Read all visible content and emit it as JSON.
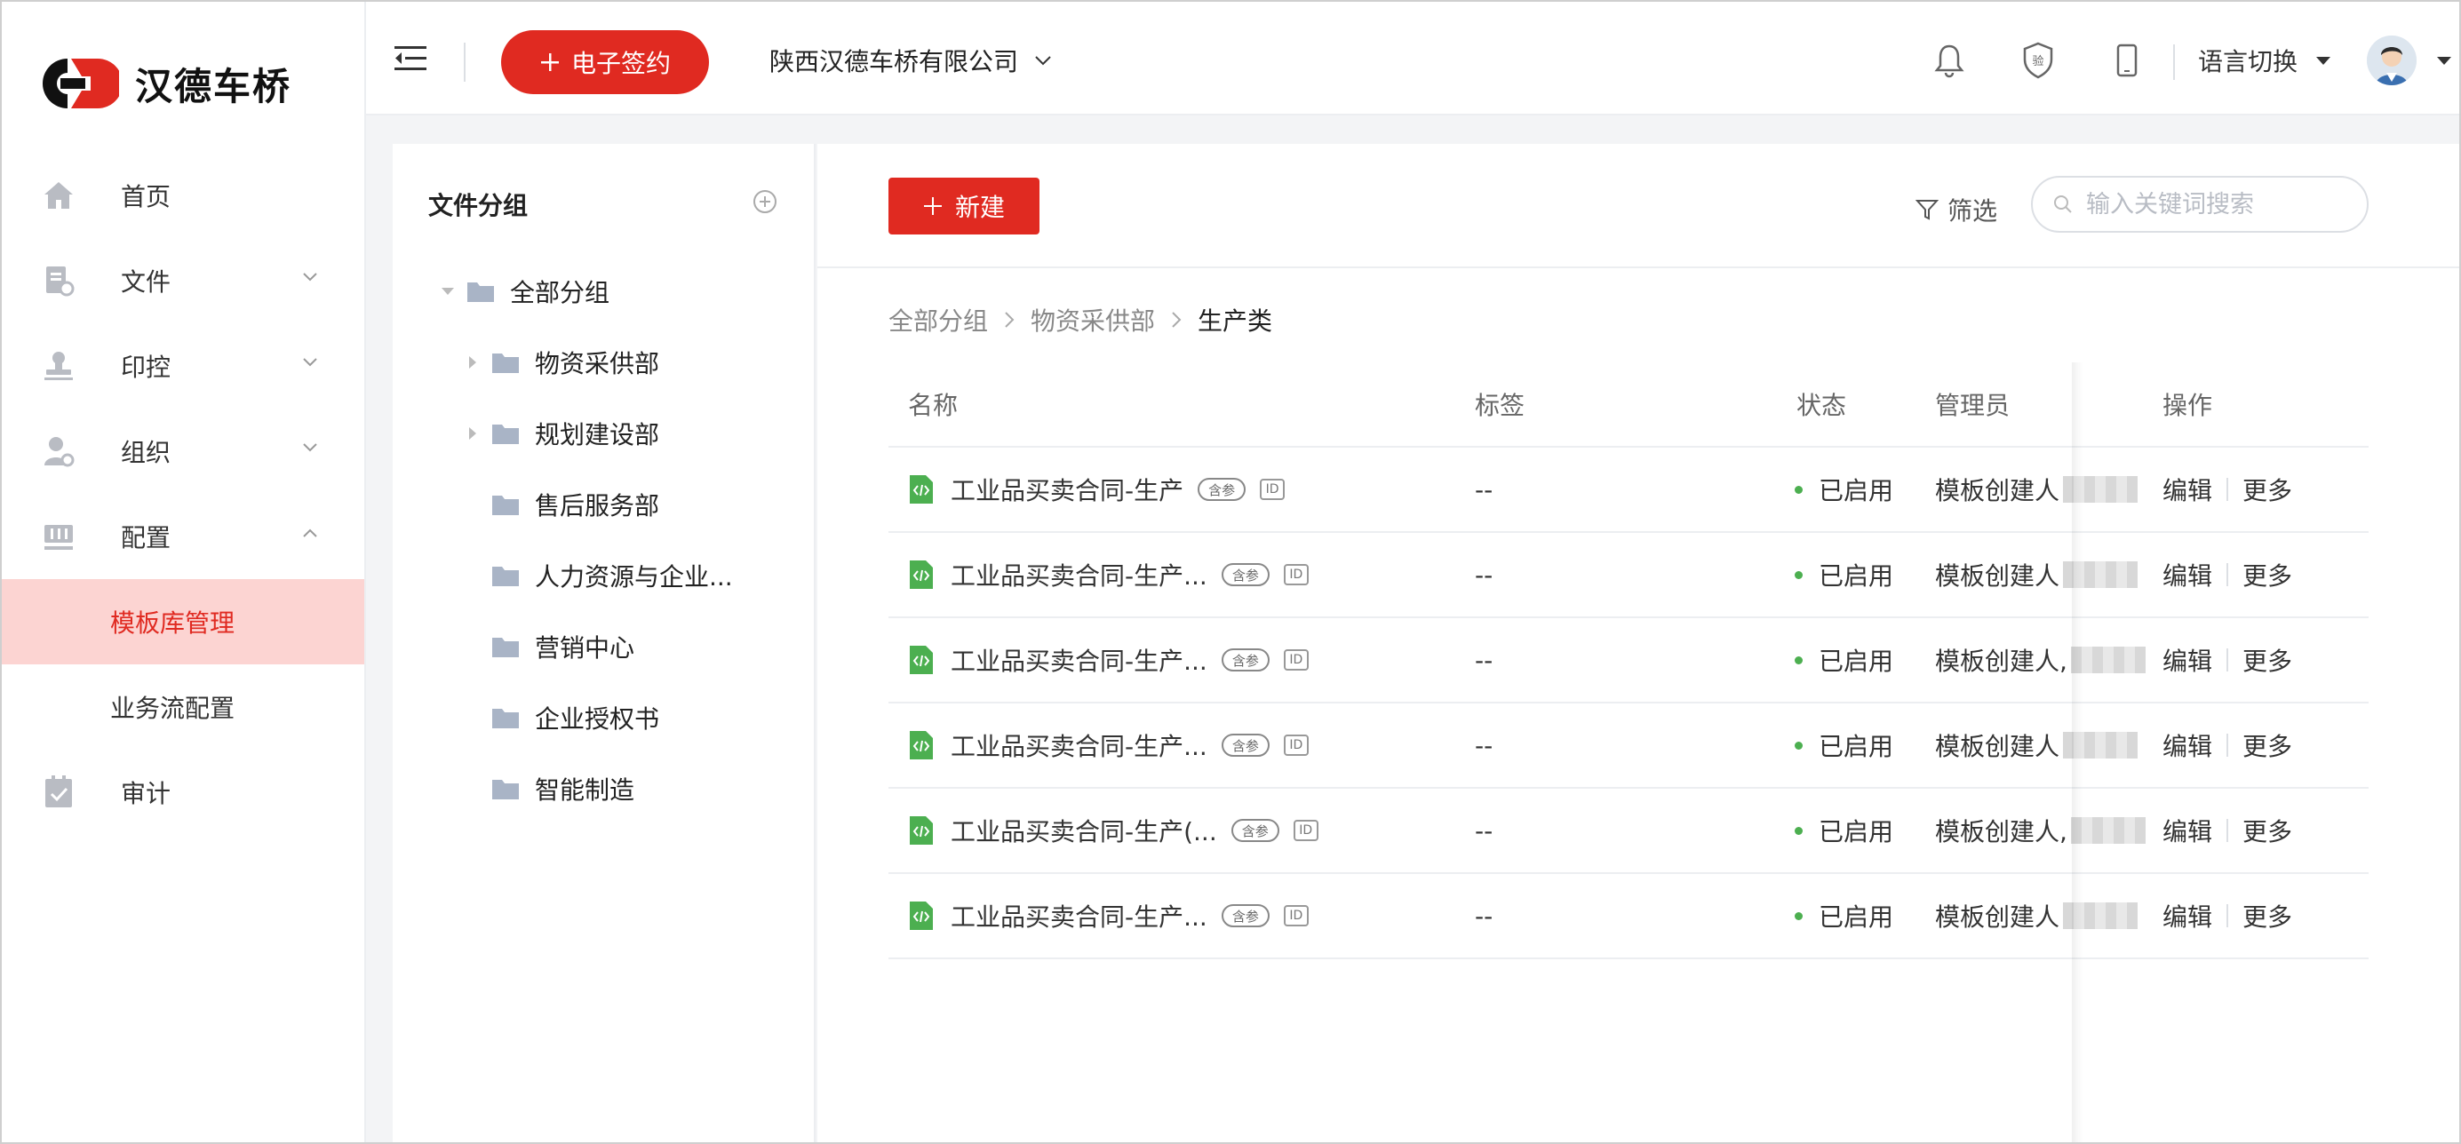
{
  "app": {
    "logo_text": "汉德车桥"
  },
  "colors": {
    "accent": "#e02a21",
    "active_bg": "#fcd4d2",
    "status_green": "#4caf50"
  },
  "sidebar": {
    "items": [
      {
        "label": "首页",
        "icon": "home-icon",
        "chevron": ""
      },
      {
        "label": "文件",
        "icon": "file-icon",
        "chevron": "down"
      },
      {
        "label": "印控",
        "icon": "stamp-icon",
        "chevron": "down"
      },
      {
        "label": "组织",
        "icon": "organization-icon",
        "chevron": "down"
      },
      {
        "label": "配置",
        "icon": "config-icon",
        "chevron": "up"
      }
    ],
    "sub_items": [
      {
        "label": "模板库管理",
        "active": true
      },
      {
        "label": "业务流配置",
        "active": false
      }
    ],
    "audit": {
      "label": "审计",
      "icon": "audit-icon"
    }
  },
  "header": {
    "esign_label": "电子签约",
    "company": "陕西汉德车桥有限公司",
    "lang_label": "语言切换"
  },
  "group_panel": {
    "title": "文件分组",
    "tree": [
      {
        "label": "全部分组",
        "level": 0,
        "caret": "down"
      },
      {
        "label": "物资采供部",
        "level": 1,
        "caret": "right"
      },
      {
        "label": "规划建设部",
        "level": 1,
        "caret": "right"
      },
      {
        "label": "售后服务部",
        "level": 1,
        "caret": ""
      },
      {
        "label": "人力资源与企业...",
        "level": 1,
        "caret": ""
      },
      {
        "label": "营销中心",
        "level": 1,
        "caret": ""
      },
      {
        "label": "企业授权书",
        "level": 1,
        "caret": ""
      },
      {
        "label": "智能制造",
        "level": 1,
        "caret": ""
      }
    ]
  },
  "toolbar": {
    "new_label": "新建",
    "filter_label": "筛选",
    "search_placeholder": "输入关键词搜索"
  },
  "breadcrumb": [
    "全部分组",
    "物资采供部",
    "生产类"
  ],
  "table": {
    "headers": {
      "name": "名称",
      "tag": "标签",
      "status": "状态",
      "admin": "管理员",
      "ops": "操作"
    },
    "badge_can": "含参",
    "badge_id": "ID",
    "edit_label": "编辑",
    "more_label": "更多",
    "rows": [
      {
        "name": "工业品买卖合同-生产",
        "tag": "--",
        "status": "已启用",
        "admin": "模板创建人"
      },
      {
        "name": "工业品买卖合同-生产...",
        "tag": "--",
        "status": "已启用",
        "admin": "模板创建人"
      },
      {
        "name": "工业品买卖合同-生产...",
        "tag": "--",
        "status": "已启用",
        "admin": "模板创建人,"
      },
      {
        "name": "工业品买卖合同-生产...",
        "tag": "--",
        "status": "已启用",
        "admin": "模板创建人"
      },
      {
        "name": "工业品买卖合同-生产(...",
        "tag": "--",
        "status": "已启用",
        "admin": "模板创建人,"
      },
      {
        "name": "工业品买卖合同-生产...",
        "tag": "--",
        "status": "已启用",
        "admin": "模板创建人"
      }
    ]
  }
}
